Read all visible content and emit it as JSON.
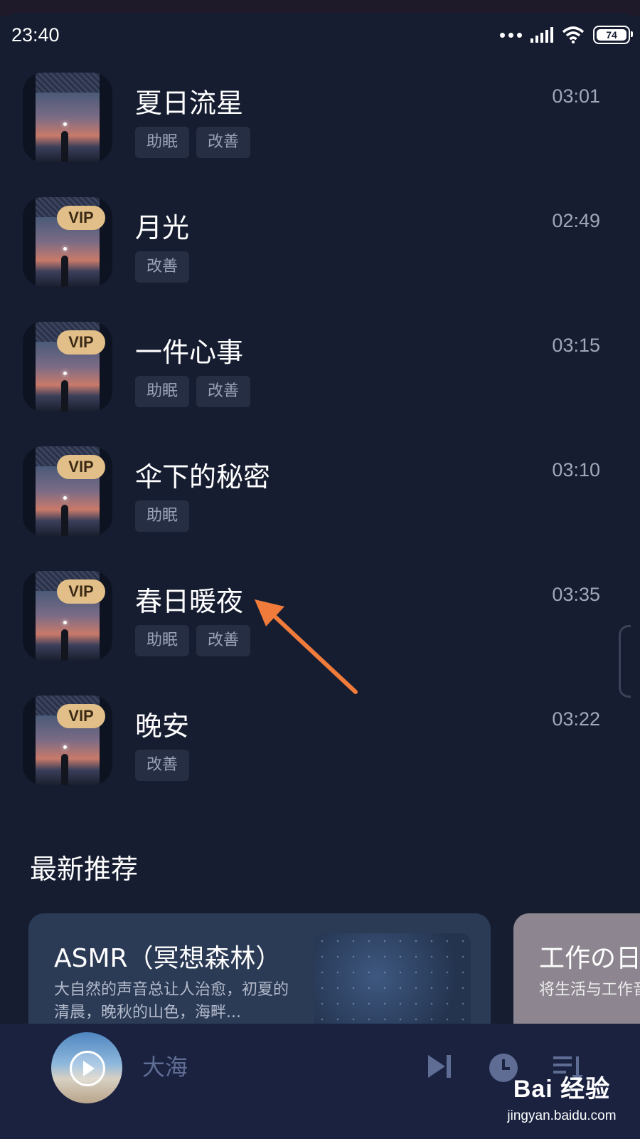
{
  "status_bar": {
    "time": "23:40",
    "battery": "74",
    "icons": [
      "dots-icon",
      "signal-icon",
      "wifi-icon",
      "battery-icon"
    ]
  },
  "tracks": [
    {
      "title": "夏日流星",
      "duration": "03:01",
      "vip": false,
      "tags": [
        "助眠",
        "改善"
      ]
    },
    {
      "title": "月光",
      "duration": "02:49",
      "vip": true,
      "vip_label": "VIP",
      "tags": [
        "改善"
      ]
    },
    {
      "title": "一件心事",
      "duration": "03:15",
      "vip": true,
      "vip_label": "VIP",
      "tags": [
        "助眠",
        "改善"
      ]
    },
    {
      "title": "伞下的秘密",
      "duration": "03:10",
      "vip": true,
      "vip_label": "VIP",
      "tags": [
        "助眠"
      ]
    },
    {
      "title": "春日暖夜",
      "duration": "03:35",
      "vip": true,
      "vip_label": "VIP",
      "tags": [
        "助眠",
        "改善"
      ]
    },
    {
      "title": "晚安",
      "duration": "03:22",
      "vip": true,
      "vip_label": "VIP",
      "tags": [
        "改善"
      ]
    }
  ],
  "section": {
    "title": "最新推荐"
  },
  "recommendations": [
    {
      "title": "ASMR（冥想森林）",
      "description": "大自然的声音总让人治愈，初夏的清晨，晚秋的山色，海畔..."
    },
    {
      "title": "工作の日",
      "description": "将生活与工作音的角度去看"
    }
  ],
  "player": {
    "now_playing": "大海"
  },
  "colors": {
    "background": "#161d31",
    "vip_gold": "#e2bf88",
    "tag_bg": "#262e44",
    "player_bg": "#1a2240",
    "annotation_arrow": "#f07b3a"
  },
  "watermark": {
    "logo": "Bai 经验",
    "url": "jingyan.baidu.com"
  }
}
